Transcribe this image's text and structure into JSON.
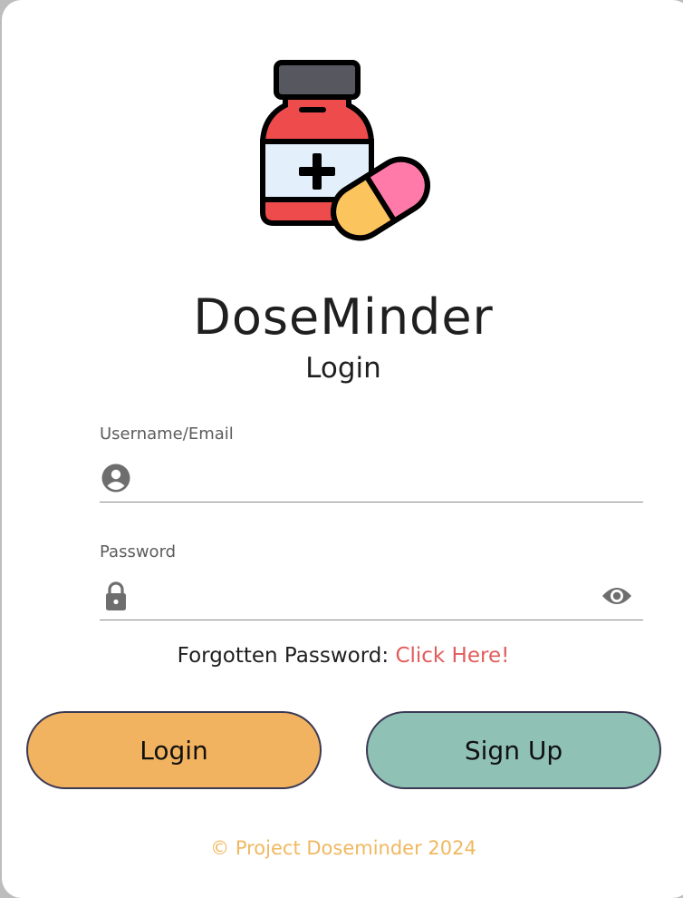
{
  "app": {
    "name": "DoseMinder",
    "subtitle": "Login",
    "logo_icon": "medicine-bottle-and-pill"
  },
  "form": {
    "username": {
      "label": "Username/Email",
      "value": "",
      "icon": "account-circle-icon"
    },
    "password": {
      "label": "Password",
      "value": "",
      "icon": "lock-icon",
      "toggle_icon": "eye-icon"
    }
  },
  "forgot": {
    "text": "Forgotten Password:",
    "link": "Click Here!"
  },
  "buttons": {
    "login": "Login",
    "signup": "Sign Up"
  },
  "footer": {
    "text": "© Project Doseminder 2024"
  },
  "colors": {
    "login_button": "#f1b35f",
    "signup_button": "#8fc1b4",
    "link": "#e25c5c",
    "footer": "#f0b860",
    "button_border": "#3b3a55"
  }
}
